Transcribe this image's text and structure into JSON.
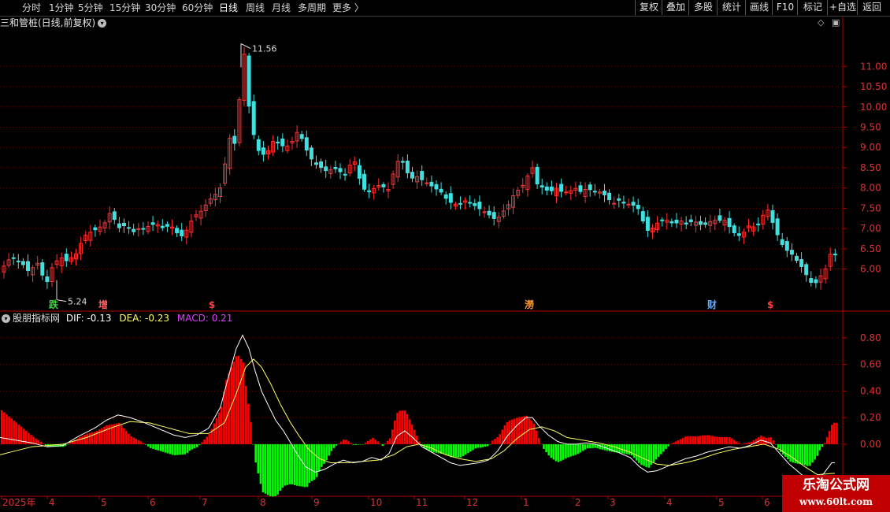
{
  "toolbar": {
    "timeframes": [
      "分时",
      "1分钟",
      "5分钟",
      "15分钟",
      "30分钟",
      "60分钟",
      "日线",
      "周线",
      "月线",
      "多周期",
      "更多 〉"
    ],
    "active_timeframe": "日线",
    "right_buttons": [
      "复权",
      "叠加",
      "多股",
      "统计",
      "画线",
      "F10",
      "标记",
      "+自选",
      "返回"
    ]
  },
  "stock": {
    "title": "三和管桩(日线,前复权)",
    "high_label": "11.56",
    "low_label": "5.24"
  },
  "event_markers": [
    {
      "text": "跌",
      "date": "2025-04-08",
      "color": "#40d040"
    },
    {
      "text": "增",
      "date": "2025-05-08",
      "color": "#ff6060"
    },
    {
      "text": "$",
      "date": "2025-06-25",
      "color": "#ff4040"
    },
    {
      "text": "澇",
      "date": "2026-01-05",
      "color": "#ff9a30"
    },
    {
      "text": "财",
      "date": "2026-04-22",
      "color": "#60a8ff"
    },
    {
      "text": "$",
      "date": "2026-05-28",
      "color": "#ff4040"
    }
  ],
  "indicator": {
    "name": "股朋指标网",
    "dif_label": "DIF: -0.13",
    "dea_label": "DEA: -0.23",
    "macd_label": "MACD: 0.21"
  },
  "price_axis": [
    6.0,
    6.5,
    7.0,
    7.5,
    8.0,
    8.5,
    9.0,
    9.5,
    10.0,
    10.5,
    11.0
  ],
  "macd_axis": [
    0.0,
    0.2,
    0.4,
    0.6,
    0.8
  ],
  "date_axis": [
    "2025年",
    "4",
    "5",
    "6",
    "7",
    "8",
    "9",
    "10",
    "11",
    "12",
    "1",
    "2",
    "3",
    "4",
    "5",
    "6"
  ],
  "colors": {
    "up": "#ff3030",
    "down": "#40e0e0",
    "hist_pos": "#ff0000",
    "hist_neg": "#00ff00",
    "dif": "#ffffff",
    "dea": "#ffff60",
    "axis": "#b00000"
  },
  "chart_data": {
    "type": "candlestick+macd",
    "price_ylim": [
      5.0,
      11.9
    ],
    "macd_ylim": [
      -0.38,
      0.9
    ],
    "close_keypoints": [
      [
        0,
        6.0
      ],
      [
        12,
        6.3
      ],
      [
        20,
        6.2
      ],
      [
        28,
        6.1
      ],
      [
        36,
        5.9
      ],
      [
        44,
        6.2
      ],
      [
        50,
        6.0
      ],
      [
        56,
        5.5
      ],
      [
        60,
        5.9
      ],
      [
        66,
        6.1
      ],
      [
        74,
        6.3
      ],
      [
        82,
        6.2
      ],
      [
        90,
        6.3
      ],
      [
        96,
        6.4
      ],
      [
        104,
        6.8
      ],
      [
        112,
        6.9
      ],
      [
        122,
        7.0
      ],
      [
        130,
        7.1
      ],
      [
        138,
        7.4
      ],
      [
        144,
        7.2
      ],
      [
        150,
        7.0
      ],
      [
        158,
        7.1
      ],
      [
        166,
        6.9
      ],
      [
        174,
        7.0
      ],
      [
        182,
        7.0
      ],
      [
        190,
        7.1
      ],
      [
        198,
        7.1
      ],
      [
        206,
        7.0
      ],
      [
        214,
        7.1
      ],
      [
        222,
        6.9
      ],
      [
        230,
        6.8
      ],
      [
        236,
        7.0
      ],
      [
        244,
        7.3
      ],
      [
        252,
        7.4
      ],
      [
        260,
        7.6
      ],
      [
        268,
        7.8
      ],
      [
        276,
        7.9
      ],
      [
        282,
        8.3
      ],
      [
        288,
        9.4
      ],
      [
        294,
        8.8
      ],
      [
        300,
        9.8
      ],
      [
        304,
        10.6
      ],
      [
        308,
        11.3
      ],
      [
        312,
        10.3
      ],
      [
        318,
        9.5
      ],
      [
        324,
        9.0
      ],
      [
        330,
        8.8
      ],
      [
        338,
        8.9
      ],
      [
        346,
        9.2
      ],
      [
        352,
        9.1
      ],
      [
        360,
        9.0
      ],
      [
        368,
        9.1
      ],
      [
        374,
        9.4
      ],
      [
        382,
        9.2
      ],
      [
        390,
        8.8
      ],
      [
        398,
        8.6
      ],
      [
        406,
        8.5
      ],
      [
        414,
        8.4
      ],
      [
        422,
        8.5
      ],
      [
        430,
        8.4
      ],
      [
        438,
        8.3
      ],
      [
        446,
        8.8
      ],
      [
        452,
        8.4
      ],
      [
        458,
        8.0
      ],
      [
        466,
        7.9
      ],
      [
        474,
        8.0
      ],
      [
        482,
        8.1
      ],
      [
        490,
        7.9
      ],
      [
        498,
        8.4
      ],
      [
        504,
        8.7
      ],
      [
        512,
        8.6
      ],
      [
        518,
        8.2
      ],
      [
        526,
        8.3
      ],
      [
        534,
        8.2
      ],
      [
        542,
        8.1
      ],
      [
        550,
        8.0
      ],
      [
        558,
        7.9
      ],
      [
        566,
        7.7
      ],
      [
        574,
        7.6
      ],
      [
        582,
        7.6
      ],
      [
        590,
        7.7
      ],
      [
        598,
        7.6
      ],
      [
        606,
        7.5
      ],
      [
        614,
        7.4
      ],
      [
        622,
        7.3
      ],
      [
        628,
        7.2
      ],
      [
        636,
        7.4
      ],
      [
        644,
        7.6
      ],
      [
        652,
        7.9
      ],
      [
        660,
        8.0
      ],
      [
        668,
        8.3
      ],
      [
        674,
        8.5
      ],
      [
        680,
        8.1
      ],
      [
        688,
        8.0
      ],
      [
        696,
        7.9
      ],
      [
        704,
        8.0
      ],
      [
        712,
        7.9
      ],
      [
        720,
        7.9
      ],
      [
        728,
        8.0
      ],
      [
        736,
        7.9
      ],
      [
        744,
        8.0
      ],
      [
        752,
        7.9
      ],
      [
        760,
        7.9
      ],
      [
        768,
        7.8
      ],
      [
        776,
        7.6
      ],
      [
        784,
        7.7
      ],
      [
        792,
        7.6
      ],
      [
        800,
        7.6
      ],
      [
        808,
        7.5
      ],
      [
        816,
        7.1
      ],
      [
        822,
        6.9
      ],
      [
        830,
        7.1
      ],
      [
        838,
        7.2
      ],
      [
        846,
        7.2
      ],
      [
        854,
        7.1
      ],
      [
        862,
        7.2
      ],
      [
        870,
        7.1
      ],
      [
        878,
        7.2
      ],
      [
        886,
        7.1
      ],
      [
        894,
        7.1
      ],
      [
        902,
        7.2
      ],
      [
        910,
        7.2
      ],
      [
        918,
        7.2
      ],
      [
        926,
        7.0
      ],
      [
        934,
        6.8
      ],
      [
        942,
        6.9
      ],
      [
        950,
        7.1
      ],
      [
        958,
        7.0
      ],
      [
        966,
        7.3
      ],
      [
        972,
        7.5
      ],
      [
        978,
        7.2
      ],
      [
        986,
        6.8
      ],
      [
        994,
        6.5
      ],
      [
        1002,
        6.4
      ],
      [
        1010,
        6.2
      ],
      [
        1018,
        6.0
      ],
      [
        1026,
        5.7
      ],
      [
        1032,
        5.6
      ],
      [
        1038,
        5.8
      ],
      [
        1044,
        5.9
      ],
      [
        1050,
        6.2
      ],
      [
        1054,
        6.5
      ],
      [
        1060,
        6.3
      ]
    ],
    "dif_keypoints": [
      [
        0,
        0.05
      ],
      [
        40,
        0.01
      ],
      [
        60,
        -0.02
      ],
      [
        80,
        -0.01
      ],
      [
        100,
        0.06
      ],
      [
        120,
        0.12
      ],
      [
        135,
        0.18
      ],
      [
        150,
        0.22
      ],
      [
        165,
        0.2
      ],
      [
        180,
        0.17
      ],
      [
        200,
        0.12
      ],
      [
        220,
        0.07
      ],
      [
        235,
        0.05
      ],
      [
        250,
        0.07
      ],
      [
        265,
        0.12
      ],
      [
        280,
        0.28
      ],
      [
        292,
        0.55
      ],
      [
        300,
        0.72
      ],
      [
        308,
        0.82
      ],
      [
        316,
        0.72
      ],
      [
        324,
        0.55
      ],
      [
        332,
        0.4
      ],
      [
        340,
        0.3
      ],
      [
        350,
        0.18
      ],
      [
        360,
        0.1
      ],
      [
        370,
        0.0
      ],
      [
        378,
        -0.08
      ],
      [
        388,
        -0.17
      ],
      [
        400,
        -0.21
      ],
      [
        412,
        -0.19
      ],
      [
        424,
        -0.15
      ],
      [
        436,
        -0.12
      ],
      [
        448,
        -0.14
      ],
      [
        460,
        -0.13
      ],
      [
        472,
        -0.1
      ],
      [
        484,
        -0.12
      ],
      [
        494,
        -0.07
      ],
      [
        504,
        0.06
      ],
      [
        514,
        0.1
      ],
      [
        524,
        0.05
      ],
      [
        536,
        -0.02
      ],
      [
        548,
        -0.06
      ],
      [
        560,
        -0.1
      ],
      [
        572,
        -0.14
      ],
      [
        584,
        -0.16
      ],
      [
        596,
        -0.15
      ],
      [
        608,
        -0.14
      ],
      [
        620,
        -0.12
      ],
      [
        632,
        -0.05
      ],
      [
        644,
        0.06
      ],
      [
        656,
        0.14
      ],
      [
        668,
        0.2
      ],
      [
        676,
        0.2
      ],
      [
        684,
        0.14
      ],
      [
        696,
        0.07
      ],
      [
        708,
        0.02
      ],
      [
        720,
        0.0
      ],
      [
        732,
        0.0
      ],
      [
        744,
        0.01
      ],
      [
        756,
        0.0
      ],
      [
        770,
        -0.03
      ],
      [
        784,
        -0.06
      ],
      [
        800,
        -0.1
      ],
      [
        812,
        -0.17
      ],
      [
        822,
        -0.21
      ],
      [
        834,
        -0.2
      ],
      [
        846,
        -0.17
      ],
      [
        858,
        -0.14
      ],
      [
        870,
        -0.11
      ],
      [
        884,
        -0.09
      ],
      [
        898,
        -0.06
      ],
      [
        912,
        -0.04
      ],
      [
        926,
        -0.02
      ],
      [
        940,
        -0.03
      ],
      [
        952,
        -0.01
      ],
      [
        966,
        0.03
      ],
      [
        978,
        0.01
      ],
      [
        990,
        -0.07
      ],
      [
        1002,
        -0.15
      ],
      [
        1014,
        -0.21
      ],
      [
        1026,
        -0.27
      ],
      [
        1036,
        -0.27
      ],
      [
        1046,
        -0.22
      ],
      [
        1056,
        -0.14
      ]
    ],
    "dea_keypoints": [
      [
        0,
        -0.08
      ],
      [
        40,
        -0.02
      ],
      [
        80,
        0.0
      ],
      [
        110,
        0.05
      ],
      [
        140,
        0.12
      ],
      [
        165,
        0.17
      ],
      [
        190,
        0.16
      ],
      [
        215,
        0.12
      ],
      [
        240,
        0.08
      ],
      [
        265,
        0.08
      ],
      [
        285,
        0.16
      ],
      [
        300,
        0.38
      ],
      [
        312,
        0.58
      ],
      [
        322,
        0.64
      ],
      [
        332,
        0.58
      ],
      [
        344,
        0.45
      ],
      [
        356,
        0.3
      ],
      [
        368,
        0.17
      ],
      [
        380,
        0.06
      ],
      [
        392,
        -0.04
      ],
      [
        406,
        -0.11
      ],
      [
        420,
        -0.14
      ],
      [
        440,
        -0.14
      ],
      [
        460,
        -0.13
      ],
      [
        480,
        -0.12
      ],
      [
        500,
        -0.08
      ],
      [
        516,
        -0.02
      ],
      [
        532,
        0.0
      ],
      [
        548,
        -0.03
      ],
      [
        566,
        -0.08
      ],
      [
        584,
        -0.11
      ],
      [
        604,
        -0.13
      ],
      [
        624,
        -0.11
      ],
      [
        640,
        -0.05
      ],
      [
        656,
        0.04
      ],
      [
        672,
        0.11
      ],
      [
        688,
        0.13
      ],
      [
        704,
        0.1
      ],
      [
        720,
        0.05
      ],
      [
        740,
        0.03
      ],
      [
        760,
        0.01
      ],
      [
        780,
        -0.02
      ],
      [
        800,
        -0.06
      ],
      [
        818,
        -0.11
      ],
      [
        834,
        -0.15
      ],
      [
        850,
        -0.16
      ],
      [
        870,
        -0.14
      ],
      [
        890,
        -0.11
      ],
      [
        910,
        -0.07
      ],
      [
        930,
        -0.04
      ],
      [
        950,
        -0.02
      ],
      [
        970,
        0.0
      ],
      [
        990,
        -0.04
      ],
      [
        1006,
        -0.1
      ],
      [
        1022,
        -0.17
      ],
      [
        1038,
        -0.23
      ],
      [
        1056,
        -0.22
      ]
    ]
  }
}
